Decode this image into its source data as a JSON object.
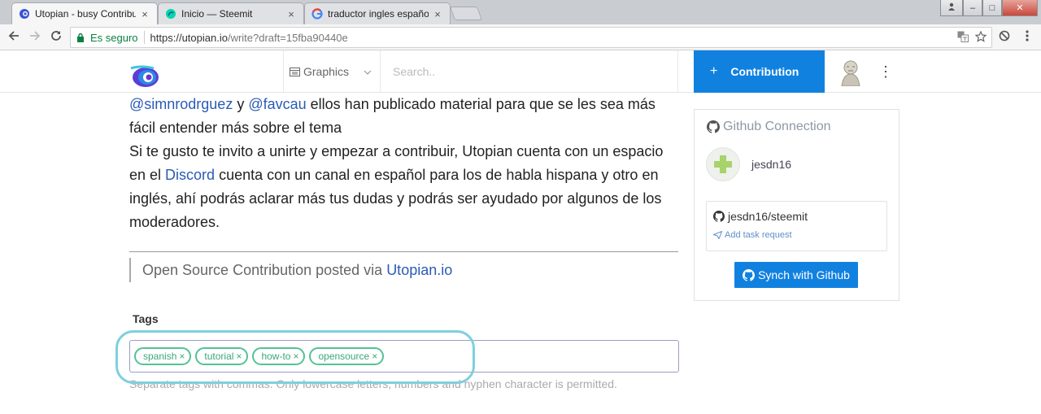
{
  "browser": {
    "tabs": [
      {
        "label": "Utopian - busy Contribut",
        "active": true,
        "favicon": "utopian-eye-icon"
      },
      {
        "label": "Inicio — Steemit",
        "active": false,
        "favicon": "steemit-icon"
      },
      {
        "label": "traductor ingles español",
        "active": false,
        "favicon": "google-icon"
      }
    ],
    "tab_close_glyph": "×",
    "window_controls": {
      "minimize": "–",
      "maximize": "□",
      "close": "✕"
    },
    "profile_icon": "user-icon",
    "secure_label": "Es seguro",
    "url_host": "https://utopian.io",
    "url_path": "/write?draft=15fba90440e"
  },
  "header": {
    "category_label": "Graphics",
    "search_placeholder": "Search..",
    "contribution_plus": "+",
    "contribution_label": "Contribution",
    "more_glyph": "⋮"
  },
  "post": {
    "mention1": "@simnrodrguez",
    "connector1": " y ",
    "mention2": "@favcau",
    "line1_rest": " ellos han publicado material para que se les sea más fácil entender más sobre el tema",
    "para2_start": "Si te gusto te invito a unirte y empezar a contribuir, Utopian cuenta con un espacio en el ",
    "discord_link": "Discord",
    "para2_end": " cuenta con un canal en español para los de habla hispana y otro en inglés, ahí podrás aclarar más tus dudas y podrás ser ayudado por algunos de los moderadores.",
    "footer_text": "Open Source Contribution posted via ",
    "footer_link": "Utopian.io"
  },
  "tags": {
    "label": "Tags",
    "items": [
      "spanish",
      "tutorial",
      "how-to",
      "opensource"
    ],
    "remove_glyph": "×",
    "hint": "Separate tags with commas. Only lowercase letters, numbers and hyphen character is permitted."
  },
  "github": {
    "title": "Github Connection",
    "username": "jesdn16",
    "repo": "jesdn16/steemit",
    "task_link": "Add task request",
    "sync_label": "Synch with Github"
  },
  "colors": {
    "accent": "#1181e0",
    "tag_green": "#56c196",
    "link_blue": "#2a5bb7",
    "highlight": "#7ed0dc"
  }
}
